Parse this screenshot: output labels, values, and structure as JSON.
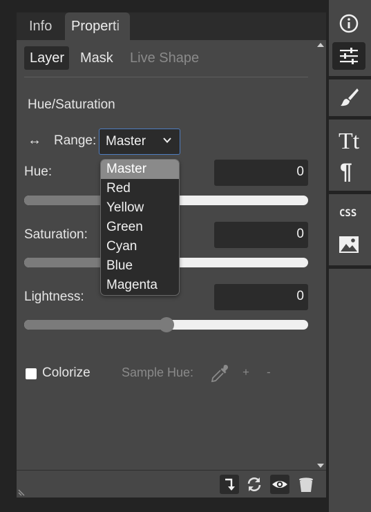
{
  "tabs": {
    "info": "Info",
    "properties": "Properti"
  },
  "subtabs": {
    "layer": "Layer",
    "mask": "Mask",
    "live_shape": "Live Shape"
  },
  "adjustment": {
    "title": "Hue/Saturation",
    "range_icon": "↔",
    "range_label": "Range:",
    "range_value": "Master",
    "hue_label": "Hue:",
    "hue_value": "0",
    "hue_slider": 0.5,
    "saturation_label": "Saturation:",
    "saturation_value": "0",
    "saturation_slider": 0.5,
    "lightness_label": "Lightness:",
    "lightness_value": "0",
    "lightness_slider": 0.5,
    "colorize_label": "Colorize",
    "colorize_checked": false,
    "sample_hue_label": "Sample Hue:",
    "plus": "+",
    "minus": "-"
  },
  "range_options": [
    "Master",
    "Red",
    "Yellow",
    "Green",
    "Cyan",
    "Blue",
    "Magenta"
  ],
  "range_selected_index": 0,
  "footer_icons": [
    "clip-to-layer-icon",
    "reset-icon",
    "visibility-eye-icon",
    "trash-icon"
  ],
  "right_toolbar": {
    "icons": [
      "info-icon",
      "adjustments-sliders-icon",
      "brush-icon",
      "character-tt-icon",
      "paragraph-icon",
      "css-icon",
      "image-icon"
    ],
    "css_text": "CSS",
    "tt_text": "Tt",
    "para_text": "¶"
  },
  "colors": {
    "accent_border": "#4f7ec1",
    "panel_bg": "#474747",
    "field_bg": "#2b2b2b",
    "selected_item": "#8a8a8a"
  }
}
